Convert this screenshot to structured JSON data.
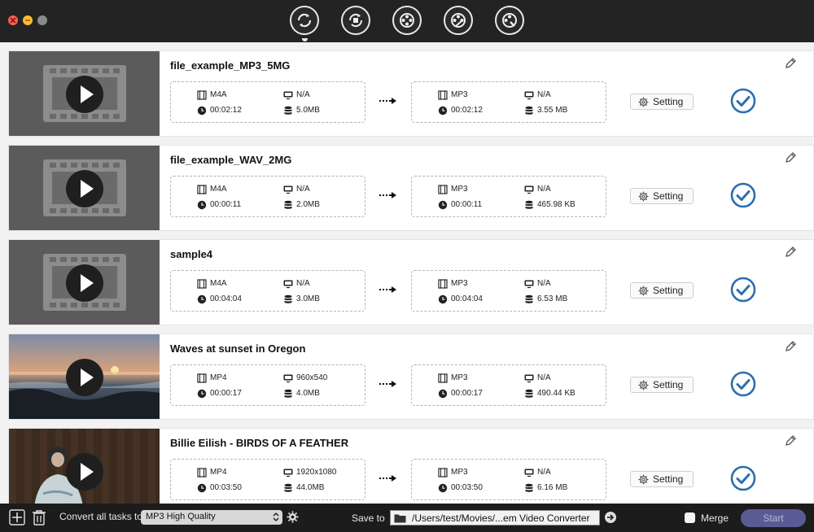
{
  "window": {
    "toolbar": [
      {
        "name": "convert-icon",
        "active": true
      },
      {
        "name": "video-convert-icon",
        "active": false
      },
      {
        "name": "film-reel-icon",
        "active": false
      },
      {
        "name": "film-edit-icon",
        "active": false
      },
      {
        "name": "film-settings-icon",
        "active": false
      }
    ]
  },
  "tasks": [
    {
      "name": "file_example_MP3_5MG",
      "thumb": "film-placeholder",
      "src": {
        "format": "M4A",
        "resolution": "N/A",
        "duration": "00:02:12",
        "size": "5.0MB"
      },
      "dst": {
        "format": "MP3",
        "resolution": "N/A",
        "duration": "00:02:12",
        "size": "3.55 MB"
      },
      "setting_label": "Setting"
    },
    {
      "name": "file_example_WAV_2MG",
      "thumb": "film-placeholder",
      "src": {
        "format": "M4A",
        "resolution": "N/A",
        "duration": "00:00:11",
        "size": "2.0MB"
      },
      "dst": {
        "format": "MP3",
        "resolution": "N/A",
        "duration": "00:00:11",
        "size": "465.98 KB"
      },
      "setting_label": "Setting"
    },
    {
      "name": "sample4",
      "thumb": "film-placeholder",
      "src": {
        "format": "M4A",
        "resolution": "N/A",
        "duration": "00:04:04",
        "size": "3.0MB"
      },
      "dst": {
        "format": "MP3",
        "resolution": "N/A",
        "duration": "00:04:04",
        "size": "6.53 MB"
      },
      "setting_label": "Setting"
    },
    {
      "name": "Waves at sunset in Oregon",
      "thumb": "sunset",
      "src": {
        "format": "MP4",
        "resolution": "960x540",
        "duration": "00:00:17",
        "size": "4.0MB"
      },
      "dst": {
        "format": "MP3",
        "resolution": "N/A",
        "duration": "00:00:17",
        "size": "490.44 KB"
      },
      "setting_label": "Setting"
    },
    {
      "name": "Billie Eilish - BIRDS OF A FEATHER",
      "thumb": "portrait",
      "src": {
        "format": "MP4",
        "resolution": "1920x1080",
        "duration": "00:03:50",
        "size": "44.0MB"
      },
      "dst": {
        "format": "MP3",
        "resolution": "N/A",
        "duration": "00:03:50",
        "size": "6.16 MB"
      },
      "setting_label": "Setting"
    }
  ],
  "bottom": {
    "convert_label": "Convert all tasks to",
    "convert_value": "MP3 High Quality",
    "save_label": "Save to",
    "save_path": "/Users/test/Movies/...em Video Converter",
    "merge_label": "Merge",
    "start_label": "Start"
  },
  "colors": {
    "accent_check": "#2a6fb0",
    "start_button": "#5a5a94",
    "titlebar": "#232323"
  }
}
